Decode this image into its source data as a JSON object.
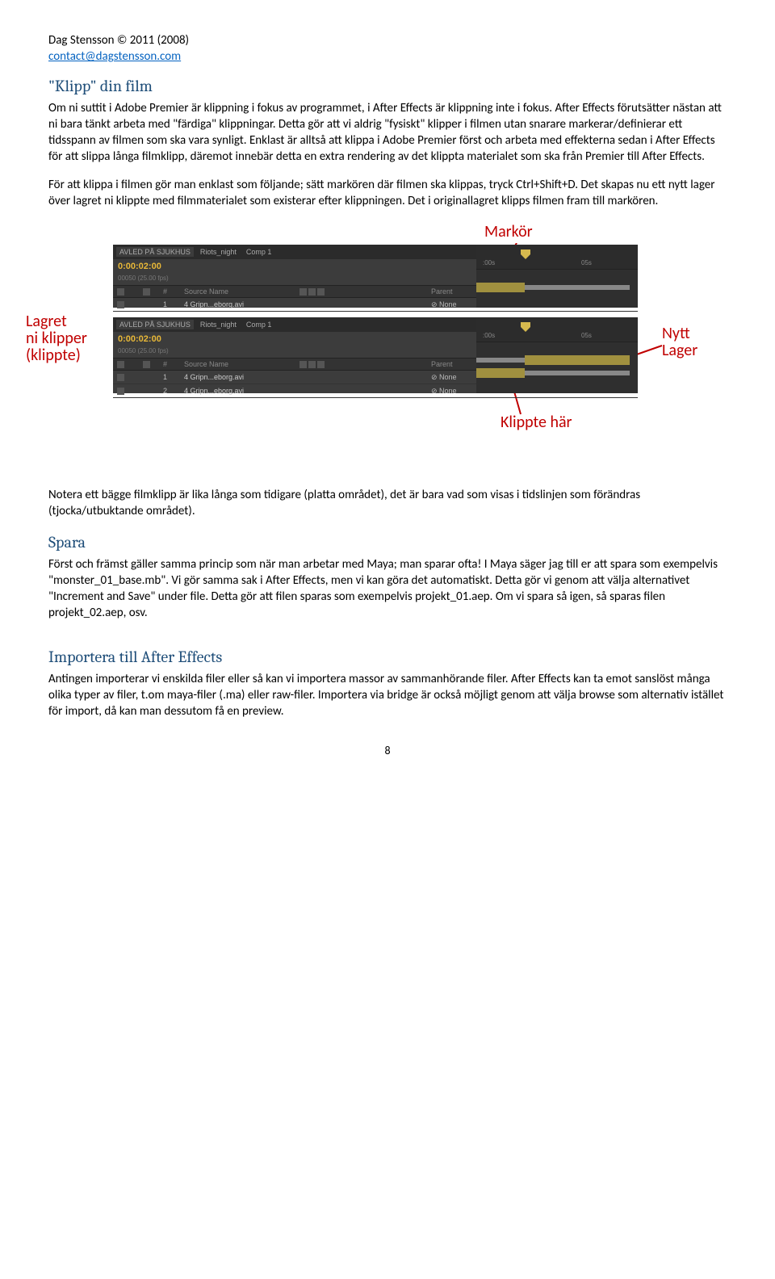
{
  "header": {
    "copyright": "Dag Stensson © 2011 (2008)",
    "email": "contact@dagstensson.com"
  },
  "section1": {
    "title": "\"Klipp\" din film",
    "para1": "Om ni suttit i Adobe Premier är klippning i fokus av programmet, i After Effects är klippning inte i fokus. After Effects förutsätter nästan att ni bara tänkt arbeta med \"färdiga\" klippningar. Detta gör att vi aldrig \"fysiskt\" klipper i filmen utan snarare markerar/definierar ett tidsspann av filmen som ska vara synligt. Enklast är alltså att klippa i Adobe Premier först och arbeta med effekterna sedan i After Effects för att slippa långa filmklipp, däremot innebär detta en extra rendering av det klippta materialet som ska från Premier till After Effects.",
    "para2": "För att klippa i filmen gör man enklast som följande; sätt markören där filmen ska klippas, tryck Ctrl+Shift+D. Det skapas nu ett nytt lager över lagret ni klippte med filmmaterialet som existerar efter klippningen. Det i originallagret klipps filmen fram till markören."
  },
  "annotations": {
    "markor": "Markör",
    "lagret": "Lagret\nni klipper\n(klippte)",
    "nytt": "Nytt\nLager",
    "klippte": "Klippte här"
  },
  "timeline": {
    "tabs": [
      "AVLED PÅ SJUKHUS",
      "Riots_night",
      "Comp 1"
    ],
    "time": "0:00:02:00",
    "fps": "00050 (25.00 fps)",
    "cols_num": "#",
    "cols_source": "Source Name",
    "cols_parent": "Parent",
    "row1_idx": "1",
    "row1_name": "4 Gripn...eborg.avi",
    "row_parent": "None",
    "row2_idx": "1",
    "row2_name": "4 Gripn...eborg.avi",
    "row3_idx": "2",
    "row3_name": "4 Gripn...eborg.avi",
    "tick0": ":00s",
    "tick5": "05s"
  },
  "note_after_fig": "Notera ett bägge filmklipp är lika långa som tidigare (platta området), det är bara vad som visas i tidslinjen som förändras (tjocka/utbuktande området).",
  "section2": {
    "title": "Spara",
    "para": "Först och främst gäller samma princip som när man arbetar med Maya; man sparar ofta! I Maya säger jag till er att spara som exempelvis \"monster_01_base.mb\". Vi gör samma sak i After Effects, men vi kan göra det automatiskt. Detta gör vi genom att välja alternativet \"Increment and Save\" under file. Detta gör att filen sparas som exempelvis projekt_01.aep. Om vi spara så igen, så sparas filen projekt_02.aep, osv."
  },
  "section3": {
    "title": "Importera till After Effects",
    "para": "Antingen importerar vi enskilda filer eller så kan vi importera massor av sammanhörande filer. After Effects kan ta emot sanslöst många olika typer av filer, t.om maya-filer (.ma) eller raw-filer. Importera via bridge är också möjligt genom att välja browse som alternativ istället för import, då kan man dessutom få en preview."
  },
  "pagenum": "8"
}
